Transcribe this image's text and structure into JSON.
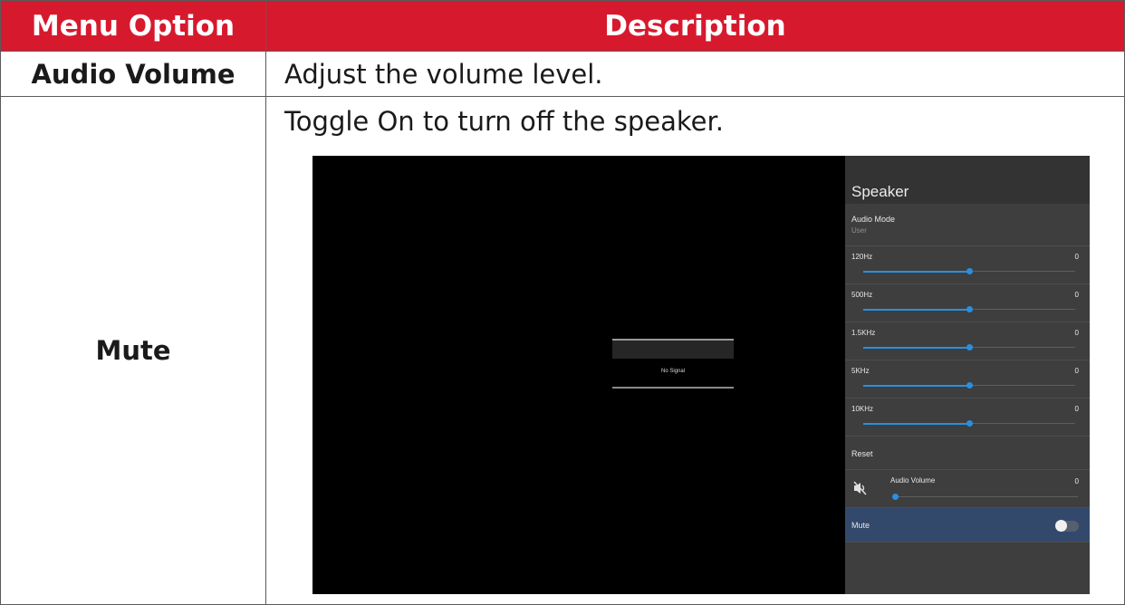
{
  "table": {
    "headers": {
      "option": "Menu Option",
      "description": "Description"
    },
    "rows": [
      {
        "option": "Audio Volume",
        "description": "Adjust the volume level."
      },
      {
        "option": "Mute",
        "description": "Toggle On to turn off the speaker."
      }
    ]
  },
  "screenshot": {
    "no_signal": "No Signal",
    "panel": {
      "title": "Speaker",
      "audio_mode": {
        "label": "Audio Mode",
        "value": "User"
      },
      "eq": [
        {
          "label": "120Hz",
          "value": "0",
          "level": 0.5
        },
        {
          "label": "500Hz",
          "value": "0",
          "level": 0.5
        },
        {
          "label": "1.5KHz",
          "value": "0",
          "level": 0.5
        },
        {
          "label": "5KHz",
          "value": "0",
          "level": 0.5
        },
        {
          "label": "10KHz",
          "value": "0",
          "level": 0.5
        }
      ],
      "reset_label": "Reset",
      "audio_volume": {
        "label": "Audio Volume",
        "value": "0",
        "level": 0.0,
        "icon": "speaker-muted-icon"
      },
      "mute": {
        "label": "Mute",
        "state": "on"
      },
      "colors": {
        "accent": "#2a8fe0",
        "highlight": "#33496c",
        "header_red": "#d7192e"
      }
    }
  }
}
